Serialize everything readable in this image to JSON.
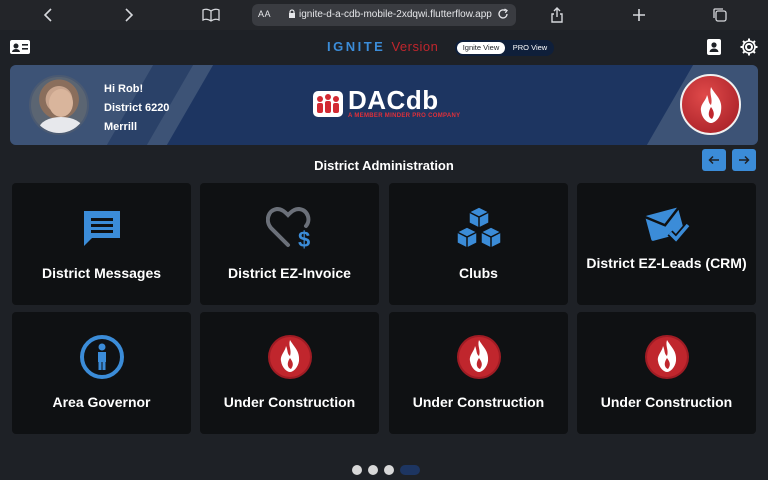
{
  "browser": {
    "text_size": "AA",
    "url": "ignite-d-a-cdb-mobile-2xdqwi.flutterflow.app"
  },
  "header": {
    "brand_ignite": "IGNITE",
    "brand_version": "Version",
    "toggle_active": "Ignite View",
    "toggle_inactive": "PRO View"
  },
  "banner": {
    "greeting": "Hi Rob!",
    "district": "District 6220",
    "club": "Merrill",
    "logo_main": "DACdb",
    "logo_sub": "A MEMBER MINDER PRO COMPANY"
  },
  "section": {
    "title": "District Administration"
  },
  "tiles": [
    {
      "label": "District Messages",
      "icon": "message-icon"
    },
    {
      "label": "District EZ-Invoice",
      "icon": "heart-dollar-icon"
    },
    {
      "label": "Clubs",
      "icon": "cubes-icon"
    },
    {
      "label": "District EZ-Leads (CRM)",
      "icon": "envelope-check-icon"
    },
    {
      "label": "Area Governor",
      "icon": "person-icon"
    },
    {
      "label": "Under Construction",
      "icon": "flame-icon"
    },
    {
      "label": "Under Construction",
      "icon": "flame-icon"
    },
    {
      "label": "Under Construction",
      "icon": "flame-icon"
    }
  ],
  "colors": {
    "accent": "#3b8cd8",
    "banner": "#1d3561",
    "brand_red": "#c0262d",
    "tile_bg": "#0f1113"
  },
  "pagination": {
    "pages": 4,
    "current": 4
  }
}
